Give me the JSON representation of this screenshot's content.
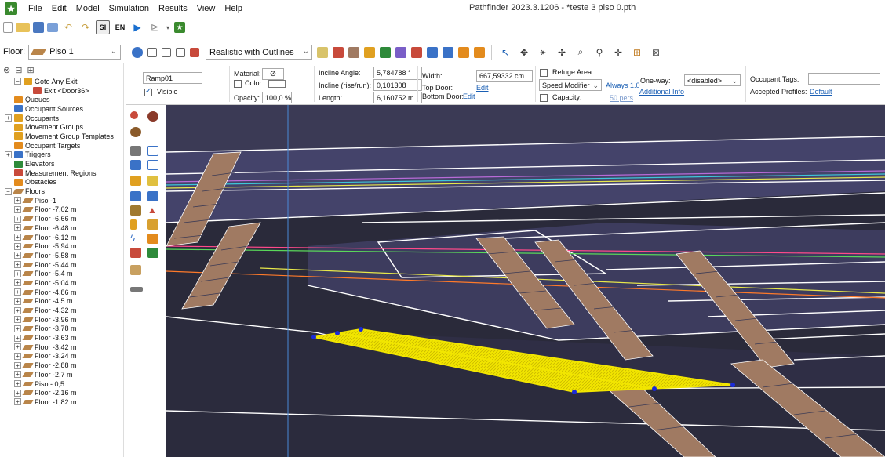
{
  "app": {
    "title": "Pathfinder 2023.3.1206 - *teste 3 piso 0.pth",
    "menu": [
      "File",
      "Edit",
      "Model",
      "Simulation",
      "Results",
      "View",
      "Help"
    ]
  },
  "toolbar": {
    "floor_label": "Floor:",
    "floor_value": "Piso 1",
    "render_mode": "Realistic with Outlines",
    "si_label": "SI",
    "en_label": "EN"
  },
  "tree": {
    "items": [
      {
        "label": "Goto Any Exit",
        "indent": 1,
        "exp": "−",
        "icon": "person"
      },
      {
        "label": "Exit <Door36>",
        "indent": 2,
        "exp": "",
        "icon": "red"
      },
      {
        "label": "Queues",
        "indent": 0,
        "exp": "",
        "icon": "orange"
      },
      {
        "label": "Occupant Sources",
        "indent": 0,
        "exp": "",
        "icon": "blue"
      },
      {
        "label": "Occupants",
        "indent": 0,
        "exp": "+",
        "icon": "person"
      },
      {
        "label": "Movement Groups",
        "indent": 0,
        "exp": "",
        "icon": "person"
      },
      {
        "label": "Movement Group Templates",
        "indent": 0,
        "exp": "",
        "icon": "person"
      },
      {
        "label": "Occupant Targets",
        "indent": 0,
        "exp": "",
        "icon": "orange"
      },
      {
        "label": "Triggers",
        "indent": 0,
        "exp": "+",
        "icon": "blue"
      },
      {
        "label": "Elevators",
        "indent": 0,
        "exp": "",
        "icon": "green"
      },
      {
        "label": "Measurement Regions",
        "indent": 0,
        "exp": "",
        "icon": "red"
      },
      {
        "label": "Obstacles",
        "indent": 0,
        "exp": "",
        "icon": "orange"
      },
      {
        "label": "Floors",
        "indent": 0,
        "exp": "−",
        "icon": "floor"
      },
      {
        "label": "Piso -1",
        "indent": 1,
        "exp": "+",
        "icon": "floor"
      },
      {
        "label": "Floor -7,02 m",
        "indent": 1,
        "exp": "+",
        "icon": "floor"
      },
      {
        "label": "Floor -6,66 m",
        "indent": 1,
        "exp": "+",
        "icon": "floor"
      },
      {
        "label": "Floor -6,48 m",
        "indent": 1,
        "exp": "+",
        "icon": "floor"
      },
      {
        "label": "Floor -6,12 m",
        "indent": 1,
        "exp": "+",
        "icon": "floor"
      },
      {
        "label": "Floor -5,94 m",
        "indent": 1,
        "exp": "+",
        "icon": "floor"
      },
      {
        "label": "Floor -5,58 m",
        "indent": 1,
        "exp": "+",
        "icon": "floor"
      },
      {
        "label": "Floor -5,44 m",
        "indent": 1,
        "exp": "+",
        "icon": "floor"
      },
      {
        "label": "Floor -5,4 m",
        "indent": 1,
        "exp": "+",
        "icon": "floor"
      },
      {
        "label": "Floor -5,04 m",
        "indent": 1,
        "exp": "+",
        "icon": "floor"
      },
      {
        "label": "Floor -4,86 m",
        "indent": 1,
        "exp": "+",
        "icon": "floor"
      },
      {
        "label": "Floor -4,5 m",
        "indent": 1,
        "exp": "+",
        "icon": "floor"
      },
      {
        "label": "Floor -4,32 m",
        "indent": 1,
        "exp": "+",
        "icon": "floor"
      },
      {
        "label": "Floor -3,96 m",
        "indent": 1,
        "exp": "+",
        "icon": "floor"
      },
      {
        "label": "Floor -3,78 m",
        "indent": 1,
        "exp": "+",
        "icon": "floor"
      },
      {
        "label": "Floor -3,63 m",
        "indent": 1,
        "exp": "+",
        "icon": "floor"
      },
      {
        "label": "Floor -3,42 m",
        "indent": 1,
        "exp": "+",
        "icon": "floor"
      },
      {
        "label": "Floor -3,24 m",
        "indent": 1,
        "exp": "+",
        "icon": "floor"
      },
      {
        "label": "Floor -2,88 m",
        "indent": 1,
        "exp": "+",
        "icon": "floor"
      },
      {
        "label": "Floor -2,7 m",
        "indent": 1,
        "exp": "+",
        "icon": "floor"
      },
      {
        "label": "Piso - 0,5",
        "indent": 1,
        "exp": "+",
        "icon": "floor"
      },
      {
        "label": "Floor -2,16 m",
        "indent": 1,
        "exp": "+",
        "icon": "floor"
      },
      {
        "label": "Floor -1,82 m",
        "indent": 1,
        "exp": "+",
        "icon": "floor"
      }
    ]
  },
  "props": {
    "name": "Ramp01",
    "material_label": "Material:",
    "color_label": "Color:",
    "visible_label": "Visible",
    "opacity_label": "Opacity:",
    "opacity_value": "100,0 %",
    "incline_angle_label": "Incline Angle:",
    "incline_angle_value": "5,784788 °",
    "incline_rise_label": "Incline (rise/run):",
    "incline_rise_value": "0,101308",
    "length_label": "Length:",
    "length_value": "6,160752 m",
    "width_label": "Width:",
    "width_value": "667,59332 cm",
    "top_door_label": "Top Door:",
    "top_door_link": "Edit",
    "bottom_door_label": "Bottom Door:",
    "bottom_door_link": "Edit",
    "refuge_label": "Refuge Area",
    "speed_modifier": "Speed Modifier",
    "always_link": "Always 1.0",
    "additional_info": "Additional Info",
    "capacity_label": "Capacity:",
    "capacity_link": "50 pers",
    "oneway_label": "One-way:",
    "oneway_value": "<disabled>",
    "tags_label": "Occupant Tags:",
    "profiles_label": "Accepted Profiles:",
    "profiles_link": "Default"
  },
  "colors": {
    "ramp_highlight": "#f2e600",
    "viewport_bg": "#2a2a3a",
    "floor_slab": "#3b3a55",
    "stair_brown": "#a07a62",
    "outline": "#ffffff",
    "link": "#1a5fb4"
  }
}
